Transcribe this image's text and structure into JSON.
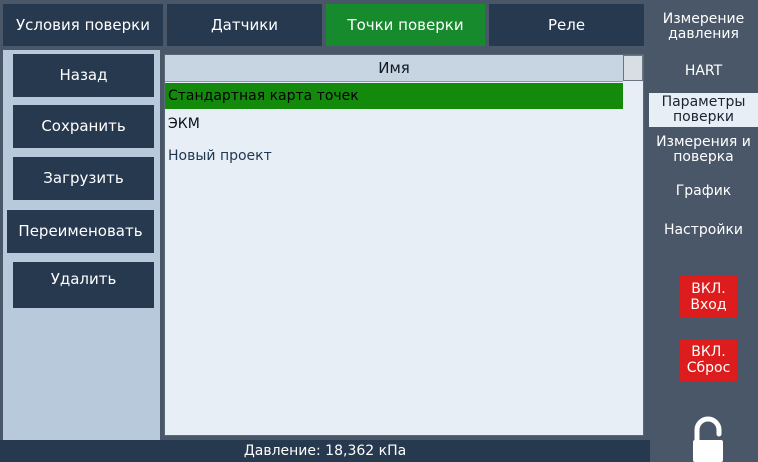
{
  "top_tabs": [
    {
      "label": "Условия поверки",
      "selected": false
    },
    {
      "label": "Датчики",
      "selected": false
    },
    {
      "label": "Точки поверки",
      "selected": true
    },
    {
      "label": "Реле",
      "selected": false
    }
  ],
  "left_buttons": [
    "Назад",
    "Сохранить",
    "Загрузить",
    "Переименовать",
    "Удалить"
  ],
  "list": {
    "header": "Имя",
    "items": [
      {
        "name": "Стандартная карта точек",
        "selected": true
      },
      {
        "name": "ЭКМ",
        "selected": false
      },
      {
        "name": "Новый проект",
        "selected": false
      }
    ]
  },
  "right_tabs": [
    {
      "label": "Измерение давления",
      "selected": false
    },
    {
      "label": "HART",
      "selected": false
    },
    {
      "label": "Параметры поверки",
      "selected": true
    },
    {
      "label": "Измерения и поверка",
      "selected": false
    },
    {
      "label": "График",
      "selected": false
    },
    {
      "label": "Настройки",
      "selected": false
    }
  ],
  "power_buttons": [
    {
      "line1": "ВКЛ.",
      "line2": "Вход"
    },
    {
      "line1": "ВКЛ.",
      "line2": "Сброс"
    }
  ],
  "status": {
    "text": "Давление: 18,362 кПа"
  },
  "lock": {
    "icon": "padlock-unlocked-icon"
  },
  "colors": {
    "background": "#4a5768",
    "button": "#27394f",
    "selected_tab": "#178a2d",
    "selected_row": "#138a0c",
    "power_button": "#dd1d1d"
  }
}
